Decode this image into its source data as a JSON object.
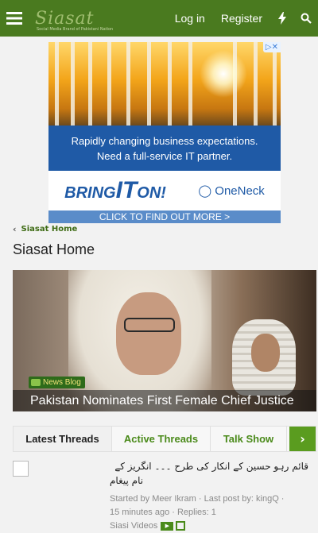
{
  "header": {
    "logo_text": "Siasat",
    "logo_tagline": "Social Media Brand of Pakistani Nation",
    "login_label": "Log in",
    "register_label": "Register",
    "colors": {
      "bar": "#4a7a1f",
      "text": "#ffffff"
    }
  },
  "ad": {
    "close_label": "▷✕",
    "line1": "Rapidly changing business expectations.",
    "line2": "Need a full-service IT partner.",
    "brand_left": "BRING",
    "brand_big": "IT",
    "brand_right": "ON!",
    "partner": "OneNeck",
    "cta": "CLICK TO FIND OUT MORE >"
  },
  "breadcrumb": {
    "label": "Siasat Home"
  },
  "page": {
    "title": "Siasat Home"
  },
  "hero": {
    "tag": "News Blog",
    "caption": "Pakistan Nominates First Female Chief Justice"
  },
  "tabs": [
    {
      "label": "Latest Threads",
      "active": true
    },
    {
      "label": "Active Threads",
      "active": false
    },
    {
      "label": "Talk Show",
      "active": false
    }
  ],
  "thread": {
    "title_line1": "قائم رہو حسین کے انکار کی طرح ۔۔۔ انگریز کے",
    "title_line2": "نام پیغام",
    "meta_line1": "Started by Meer Ikram · Last post by: kingQ ·",
    "meta_line2": "15 minutes ago · Replies: 1",
    "forum": "Siasi Videos"
  }
}
